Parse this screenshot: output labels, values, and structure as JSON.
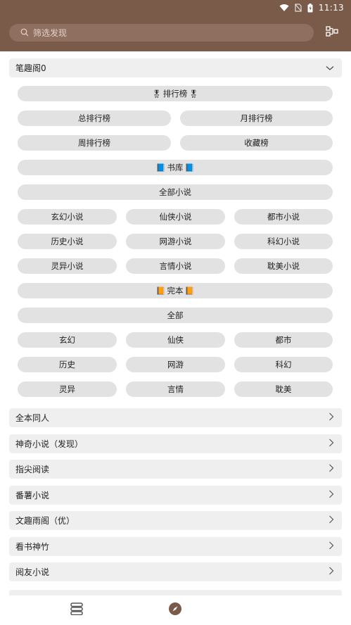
{
  "status": {
    "time": "11:13"
  },
  "search": {
    "placeholder": "筛选发现"
  },
  "header": {
    "action_icon": "mode-toggle-icon"
  },
  "groups": [
    {
      "title": "笔趣阁0",
      "expanded": true
    },
    {
      "title": "全本同人"
    },
    {
      "title": "神奇小说（发现）"
    },
    {
      "title": "指尖阅读"
    },
    {
      "title": "番薯小说"
    },
    {
      "title": "文趣雨阁（优）"
    },
    {
      "title": "看书神竹"
    },
    {
      "title": "阅友小说"
    }
  ],
  "expanded_group": {
    "items": [
      "排行榜",
      "总排行榜",
      "月排行榜",
      "周排行榜",
      "收藏榜",
      "书库",
      "全部小说",
      "玄幻小说",
      "仙侠小说",
      "都市小说",
      "历史小说",
      "网游小说",
      "科幻小说",
      "灵异小说",
      "言情小说",
      "耽美小说",
      "完本",
      "全部",
      "玄幻",
      "仙侠",
      "都市",
      "历史",
      "网游",
      "科幻",
      "灵异",
      "言情",
      "耽美"
    ],
    "emoji": {
      "rank": "🎖",
      "library": "📘",
      "complete": "📙"
    }
  },
  "colors": {
    "header_bg": "#7a5a49",
    "pill_bg": "#e2e2e2",
    "section_bg": "#efefef"
  },
  "bottom_nav": {
    "bookshelf_icon": "bookshelf-icon",
    "discover_icon": "compass-icon"
  }
}
